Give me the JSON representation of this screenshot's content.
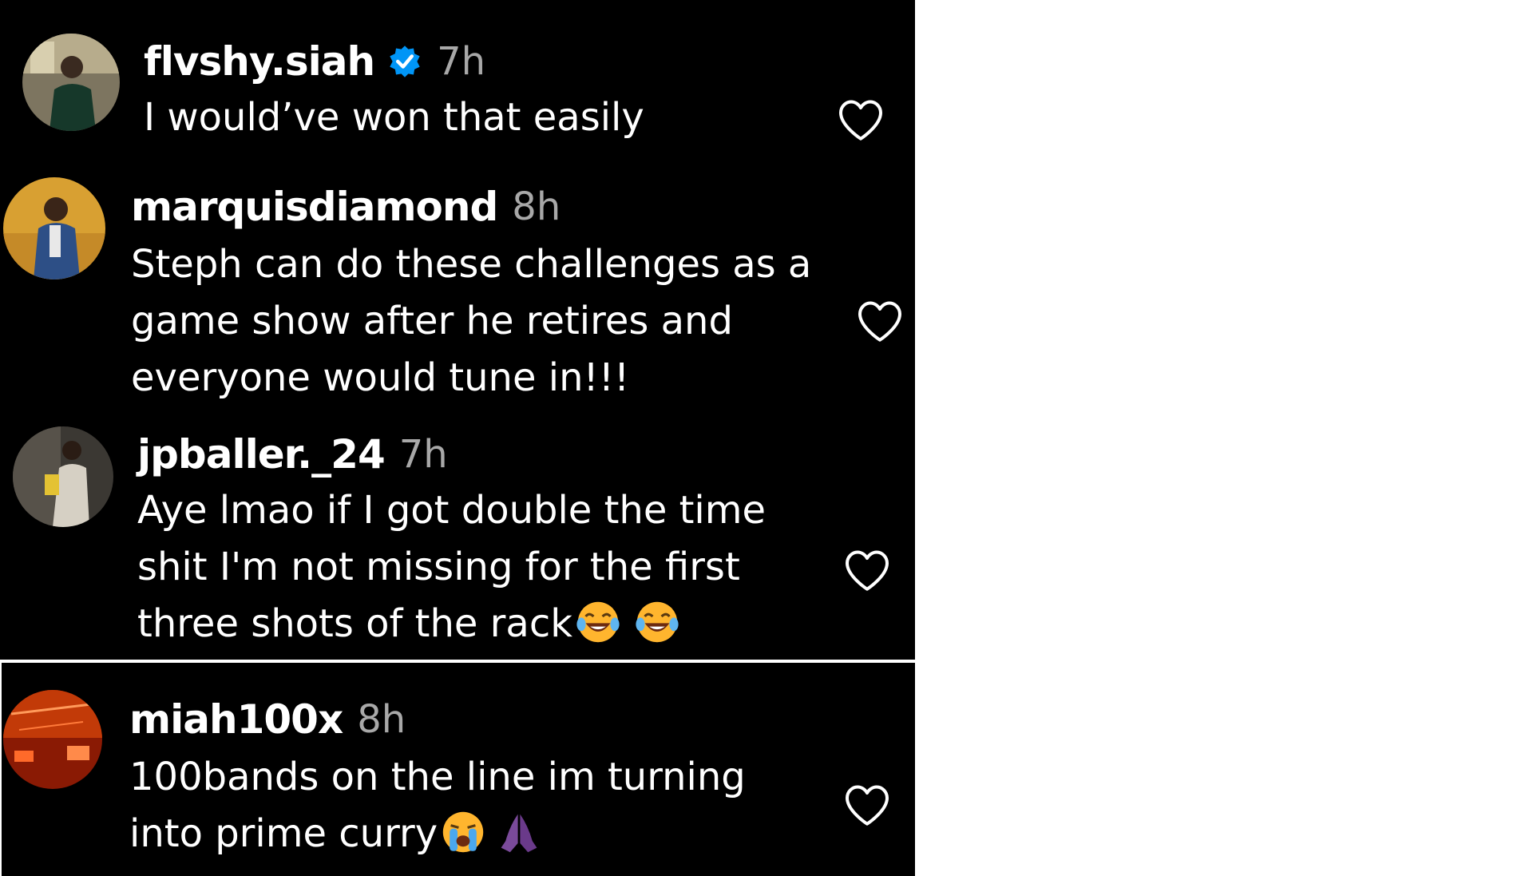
{
  "comments": [
    {
      "username": "flvshy.siah",
      "verified": true,
      "time": "7h",
      "lines": [
        "I would’ve won that easily"
      ],
      "avatar": "avatar-icon"
    },
    {
      "username": "marquisdiamond",
      "verified": false,
      "time": "8h",
      "lines": [
        "Steph can do these challenges as a",
        "game show after he retires and",
        "everyone would tune in!!!"
      ],
      "avatar": "avatar-icon"
    },
    {
      "username": "jpballer._24",
      "verified": false,
      "time": "7h",
      "lines": [
        "Aye lmao if I got double the time",
        "shit I'm not missing for the first",
        "three shots of the rack"
      ],
      "emojis": [
        "laughing-crying-emoji",
        "laughing-crying-emoji"
      ],
      "avatar": "avatar-icon"
    },
    {
      "username": "miah100x",
      "verified": false,
      "time": "8h",
      "lines": [
        "100bands on the line im turning",
        "into prime curry"
      ],
      "emojis": [
        "loudly-crying-emoji",
        "praying-hands-emoji"
      ],
      "avatar": "avatar-icon"
    }
  ],
  "colors": {
    "background": "#000000",
    "username": "#ffffff",
    "timestamp": "#a8a8a8",
    "verified_badge": "#0095f6",
    "heart_outline": "#ffffff"
  }
}
